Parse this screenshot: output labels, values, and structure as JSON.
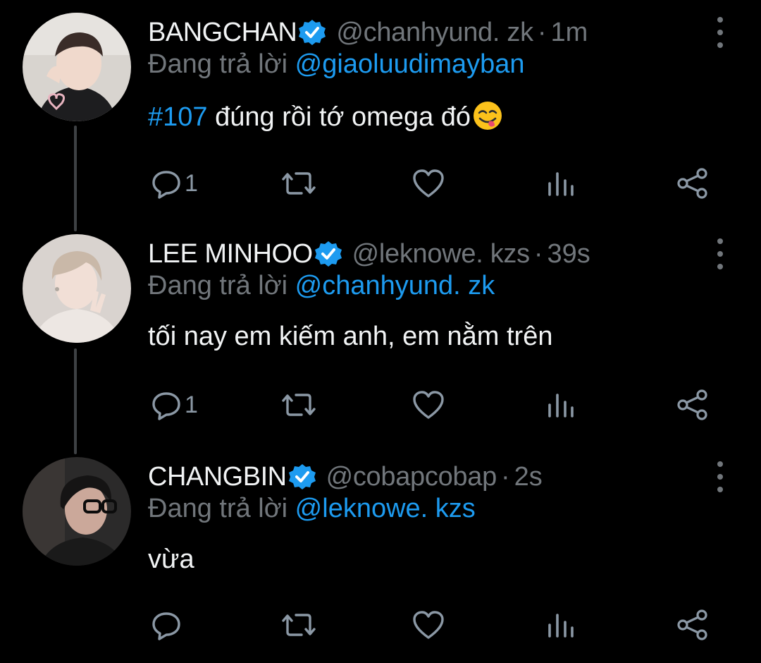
{
  "thread": [
    {
      "name": "BANGCHAN",
      "handle": "@chanhyund. zk",
      "time": "1m",
      "reply_prefix": "Đang trả lời",
      "reply_to": "@giaoluudimayban",
      "hashtag": "#107",
      "text": " đúng rồi tớ omega đó",
      "emoji": "face-savoring-food-emoji",
      "reply_count": "1",
      "avatar_colors": {
        "bg": "#d8d4cf",
        "skin": "#f0d9cc",
        "hair": "#3a2c28",
        "shirt": "#1d1d1f"
      }
    },
    {
      "name": "LEE MINHOO",
      "handle": "@leknowe. kzs",
      "time": "39s",
      "reply_prefix": "Đang trả lời",
      "reply_to": "@chanhyund. zk",
      "text": "tối nay em kiếm anh, em nằm trên",
      "reply_count": "1",
      "avatar_colors": {
        "bg": "#d9d3cf",
        "skin": "#f1dfd6",
        "hair": "#c9b8a8",
        "shirt": "#ede7e3"
      }
    },
    {
      "name": "CHANGBIN",
      "handle": "@cobapcobap",
      "time": "2s",
      "reply_prefix": "Đang trả lời",
      "reply_to": "@leknowe. kzs",
      "text": "vừa",
      "reply_count": "",
      "avatar_colors": {
        "bg": "#2b2a2a",
        "skin": "#cba89a",
        "hair": "#151414",
        "shirt": "#1a1a1a"
      }
    }
  ],
  "colors": {
    "background": "#000000",
    "accent": "#1d9bf0",
    "muted": "#71767b",
    "icon": "#8b98a5",
    "verified": "#1d9bf0"
  },
  "icons": {
    "reply": "reply-icon",
    "retweet": "retweet-icon",
    "like": "heart-icon",
    "views": "views-icon",
    "share": "share-icon",
    "more": "more-vertical-icon",
    "verified": "verified-badge-icon"
  },
  "separator": "·"
}
